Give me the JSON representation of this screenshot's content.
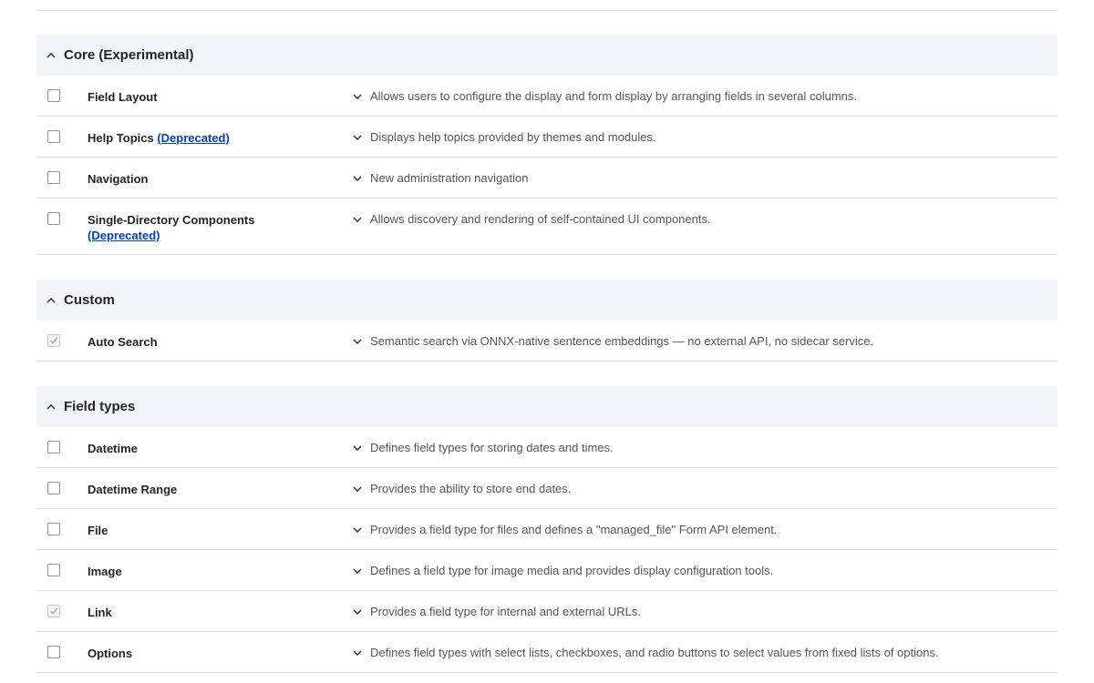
{
  "groups": [
    {
      "title": "Core (Experimental)",
      "modules": [
        {
          "name": "Field Layout",
          "deprecated": "",
          "checked": false,
          "description": "Allows users to configure the display and form display by arranging fields in several columns."
        },
        {
          "name": "Help Topics",
          "deprecated": "(Deprecated)",
          "checked": false,
          "description": "Displays help topics provided by themes and modules."
        },
        {
          "name": "Navigation",
          "deprecated": "",
          "checked": false,
          "description": "New administration navigation"
        },
        {
          "name": "Single-Directory Components",
          "deprecated": "(Deprecated)",
          "checked": false,
          "description": "Allows discovery and rendering of self-contained UI components."
        }
      ]
    },
    {
      "title": "Custom",
      "modules": [
        {
          "name": "Auto Search",
          "deprecated": "",
          "checked": true,
          "description": "Semantic search via ONNX-native sentence embeddings — no external API, no sidecar service."
        }
      ]
    },
    {
      "title": "Field types",
      "modules": [
        {
          "name": "Datetime",
          "deprecated": "",
          "checked": false,
          "description": "Defines field types for storing dates and times."
        },
        {
          "name": "Datetime Range",
          "deprecated": "",
          "checked": false,
          "description": "Provides the ability to store end dates."
        },
        {
          "name": "File",
          "deprecated": "",
          "checked": false,
          "description": "Provides a field type for files and defines a \"managed_file\" Form API element."
        },
        {
          "name": "Image",
          "deprecated": "",
          "checked": false,
          "description": "Defines a field type for image media and provides display configuration tools."
        },
        {
          "name": "Link",
          "deprecated": "",
          "checked": true,
          "description": "Provides a field type for internal and external URLs."
        },
        {
          "name": "Options",
          "deprecated": "",
          "checked": false,
          "description": "Defines field types with select lists, checkboxes, and radio buttons to select values from fixed lists of options."
        }
      ]
    }
  ],
  "icons": {
    "group_toggle": "chevron-up-icon",
    "description_toggle": "chevron-down-icon",
    "checked_mark": "check-icon"
  },
  "colors": {
    "group_header_bg": "#f3f4f9",
    "link": "#003ecc",
    "divider": "#dedfe4"
  }
}
